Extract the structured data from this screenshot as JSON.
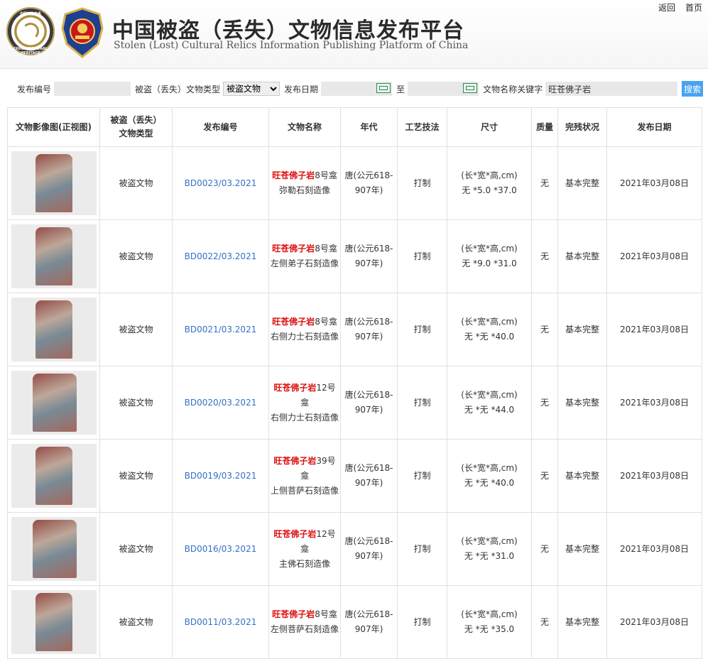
{
  "header": {
    "title_cn": "中国被盗（丢失）文物信息发布平台",
    "title_en": "Stolen (Lost) Cultural Relics Information Publishing Platform of China",
    "emblem_top_text": "中国文物信息",
    "emblem_bottom_text": "CHINA CULTURAL HERITAGE",
    "links": {
      "back": "返回",
      "home": "首页"
    }
  },
  "search": {
    "code_label": "发布编号",
    "code_value": "",
    "type_label": "被盗（丢失）文物类型",
    "type_selected": "被盗文物",
    "date_label": "发布日期",
    "date_from": "",
    "date_to_label": "至",
    "date_to": "",
    "keyword_label": "文物名称关键字",
    "keyword_value": "旺苍佛子岩",
    "search_button": "搜索"
  },
  "table": {
    "headers": {
      "image": "文物影像图(正视图)",
      "type_line1": "被盗（丢失）",
      "type_line2": "文物类型",
      "code": "发布编号",
      "name": "文物名称",
      "era": "年代",
      "craft": "工艺技法",
      "size": "尺寸",
      "quality": "质量",
      "condition": "完残状况",
      "date": "发布日期"
    },
    "rows": [
      {
        "type": "被盗文物",
        "code": "BD0023/03.2021",
        "name_kw": "旺苍佛子岩",
        "name_rest1": "8号龛",
        "name_line2": "弥勒石刻造像",
        "era1": "唐(公元618-",
        "era2": "907年)",
        "craft": "打制",
        "size1": "(长*宽*高,cm)",
        "size2": "无 *5.0 *37.0",
        "quality": "无",
        "condition": "基本完整",
        "date": "2021年03月08日"
      },
      {
        "type": "被盗文物",
        "code": "BD0022/03.2021",
        "name_kw": "旺苍佛子岩",
        "name_rest1": "8号龛",
        "name_line2": "左侧弟子石刻造像",
        "era1": "唐(公元618-",
        "era2": "907年)",
        "craft": "打制",
        "size1": "(长*宽*高,cm)",
        "size2": "无 *9.0 *31.0",
        "quality": "无",
        "condition": "基本完整",
        "date": "2021年03月08日"
      },
      {
        "type": "被盗文物",
        "code": "BD0021/03.2021",
        "name_kw": "旺苍佛子岩",
        "name_rest1": "8号龛",
        "name_line2": "右侧力士石刻造像",
        "era1": "唐(公元618-",
        "era2": "907年)",
        "craft": "打制",
        "size1": "(长*宽*高,cm)",
        "size2": "无 *无 *40.0",
        "quality": "无",
        "condition": "基本完整",
        "date": "2021年03月08日"
      },
      {
        "type": "被盗文物",
        "code": "BD0020/03.2021",
        "name_kw": "旺苍佛子岩",
        "name_rest1": "12号龛",
        "name_line2": "右侧力士石刻造像",
        "era1": "唐(公元618-",
        "era2": "907年)",
        "craft": "打制",
        "size1": "(长*宽*高,cm)",
        "size2": "无 *无 *44.0",
        "quality": "无",
        "condition": "基本完整",
        "date": "2021年03月08日"
      },
      {
        "type": "被盗文物",
        "code": "BD0019/03.2021",
        "name_kw": "旺苍佛子岩",
        "name_rest1": "39号龛",
        "name_line2": "上侧菩萨石刻造像",
        "era1": "唐(公元618-",
        "era2": "907年)",
        "craft": "打制",
        "size1": "(长*宽*高,cm)",
        "size2": "无 *无 *40.0",
        "quality": "无",
        "condition": "基本完整",
        "date": "2021年03月08日"
      },
      {
        "type": "被盗文物",
        "code": "BD0016/03.2021",
        "name_kw": "旺苍佛子岩",
        "name_rest1": "12号龛",
        "name_line2": "主佛石刻造像",
        "era1": "唐(公元618-",
        "era2": "907年)",
        "craft": "打制",
        "size1": "(长*宽*高,cm)",
        "size2": "无 *无 *31.0",
        "quality": "无",
        "condition": "基本完整",
        "date": "2021年03月08日"
      },
      {
        "type": "被盗文物",
        "code": "BD0011/03.2021",
        "name_kw": "旺苍佛子岩",
        "name_rest1": "8号龛",
        "name_line2": "左侧菩萨石刻造像",
        "era1": "唐(公元618-",
        "era2": "907年)",
        "craft": "打制",
        "size1": "(长*宽*高,cm)",
        "size2": "无 *无 *35.0",
        "quality": "无",
        "condition": "基本完整",
        "date": "2021年03月08日"
      }
    ]
  }
}
